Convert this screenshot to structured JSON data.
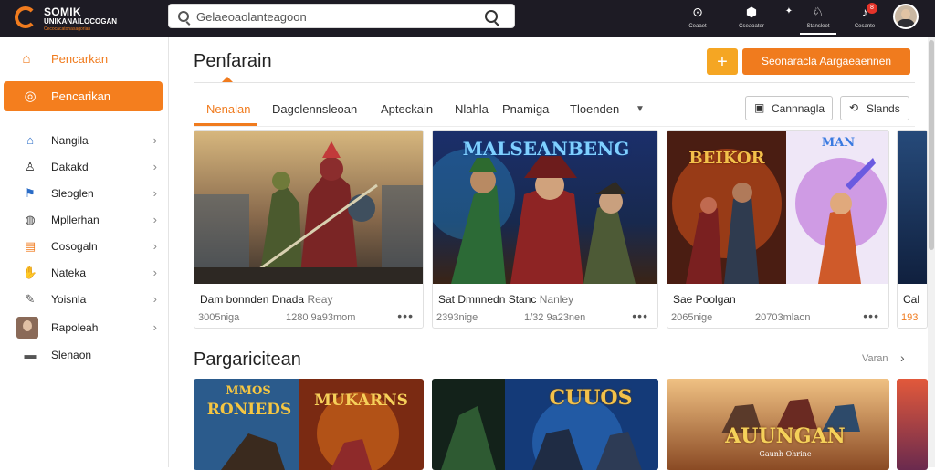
{
  "header": {
    "logo_title": "SOMIK",
    "logo_subtitle": "UNIKANAILOCOGAN",
    "logo_tagline": "Cecocacatonasagorian",
    "search_placeholder": "Gelaeoaolanteagoon",
    "nav": [
      {
        "label": "Ceaaet",
        "icon": "compass-icon",
        "glyph": "⊙"
      },
      {
        "label": "Cseaoater",
        "icon": "game-controller-icon",
        "glyph": "⬢"
      },
      {
        "label": "",
        "icon": "sparkle-icon",
        "glyph": "✦"
      },
      {
        "label": "Stansleet",
        "icon": "user-icon",
        "glyph": "♘"
      },
      {
        "label": "Cesante",
        "icon": "bell-icon",
        "glyph": "♪",
        "badge": "8"
      }
    ]
  },
  "sidebar": {
    "home": {
      "label": "Pencarkan",
      "icon": "home-icon"
    },
    "active": {
      "label": "Pencarikan",
      "icon": "explore-icon"
    },
    "items": [
      {
        "label": "Nangila",
        "icon": "house-icon",
        "glyph": "⌂"
      },
      {
        "label": "Dakakd",
        "icon": "people-icon",
        "glyph": "♙"
      },
      {
        "label": "Sleoglen",
        "icon": "flag-icon",
        "glyph": "⚑"
      },
      {
        "label": "Mpllerhan",
        "icon": "gamepad-icon",
        "glyph": "◍"
      },
      {
        "label": "Cosogaln",
        "icon": "ticket-icon",
        "glyph": "▤"
      },
      {
        "label": "Nateka",
        "icon": "hand-icon",
        "glyph": "✋"
      },
      {
        "label": "Yoisnla",
        "icon": "wrench-icon",
        "glyph": "✎"
      },
      {
        "label": "Rapoleah",
        "icon": "profile-photo",
        "glyph": ""
      },
      {
        "label": "Slenaon",
        "icon": "folder-icon",
        "glyph": "▬"
      }
    ]
  },
  "main": {
    "title": "Penfarain",
    "plus_label": "+",
    "primary_button": "Seonaracla Aargaeaennen",
    "tabs": [
      {
        "label": "Nenalan",
        "active": true
      },
      {
        "label": "Dagclennsleoan",
        "active": false
      },
      {
        "label": "Apteckain",
        "active": false
      },
      {
        "label": "Nlahla",
        "active": false
      },
      {
        "label": "Pnamiga",
        "active": false
      },
      {
        "label": "Tloenden",
        "active": false
      }
    ],
    "btn_cannagla": "Cannnagla",
    "btn_slands": "Slands",
    "cards": [
      {
        "title": "Dam bonnden Dnada",
        "title_muted": "Reay",
        "meta_left": "3005niga",
        "meta_right": "1280 9a93mom"
      },
      {
        "title": "Sat Dmnnedn Stanc",
        "title_muted": "Nanley",
        "meta_left": "2393nige",
        "meta_right": "1/32 9a23nen"
      },
      {
        "title": "Sae Poolgan",
        "title_muted": "",
        "meta_left": "2065nige",
        "meta_right": "20703mlaon"
      },
      {
        "title": "Cal",
        "title_muted": "",
        "meta_left": "193",
        "meta_right": ""
      }
    ],
    "card_art": {
      "card2": "MALSEANBENG",
      "card3_left": "BEIKOR",
      "card3_right": "MAN"
    },
    "section_title": "Pargaricitean",
    "view_more": "Varan",
    "row2": [
      {
        "art_top": "MMOS",
        "art_bottom": "RONIEDS",
        "art_right": "MUKARNS"
      },
      {
        "art_right": "CUUOS"
      },
      {
        "art_main": "AUUNGAN",
        "art_sub": "Gaunh Ohrine"
      }
    ]
  }
}
